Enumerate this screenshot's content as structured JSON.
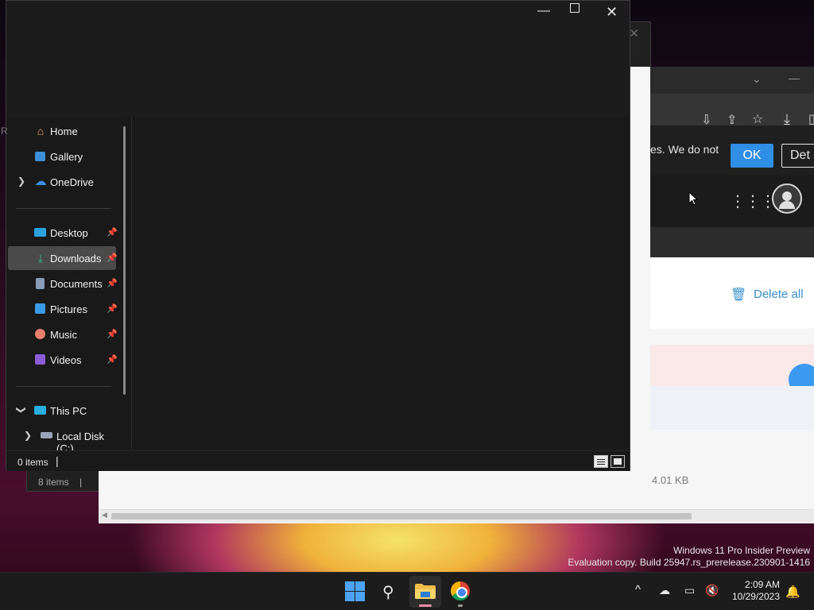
{
  "background_explorer": {
    "close_glyph": "✕",
    "status_text": "8 items",
    "status_pipe": "|"
  },
  "chrome": {
    "tab_chevron": "⌄",
    "minimize_glyph": "—",
    "cookie_text": "es. We do not",
    "ok_label": "OK",
    "detail_label": "Det",
    "delete_all_label": "Delete all",
    "size_text": "4.01 KB",
    "accent": "#2f8fe6",
    "link_color": "#3b8fd0"
  },
  "explorer": {
    "minimize_glyph": "—",
    "close_glyph": "✕",
    "side_letter": "R",
    "nav": {
      "home": "Home",
      "gallery": "Gallery",
      "onedrive": "OneDrive",
      "desktop": "Desktop",
      "downloads": "Downloads",
      "documents": "Documents",
      "pictures": "Pictures",
      "music": "Music",
      "videos": "Videos",
      "this_pc": "This PC",
      "local_disk": "Local Disk (C:)"
    },
    "selected": "Downloads",
    "status_text": "0 items",
    "status_pipe": "|"
  },
  "watermark": {
    "line1": "Windows 11 Pro Insider Preview",
    "line2": "Evaluation copy. Build 25947.rs_prerelease.230901-1416"
  },
  "taskbar": {
    "time": "2:09 AM",
    "date": "10/29/2023",
    "chevron_up": "^",
    "icons": [
      "start-icon",
      "search-icon",
      "file-explorer-icon",
      "chrome-icon"
    ],
    "tray_icons": [
      "show-hidden-icons-icon",
      "weather-icon",
      "network-icon",
      "volume-muted-icon",
      "notification-bell-icon"
    ]
  }
}
